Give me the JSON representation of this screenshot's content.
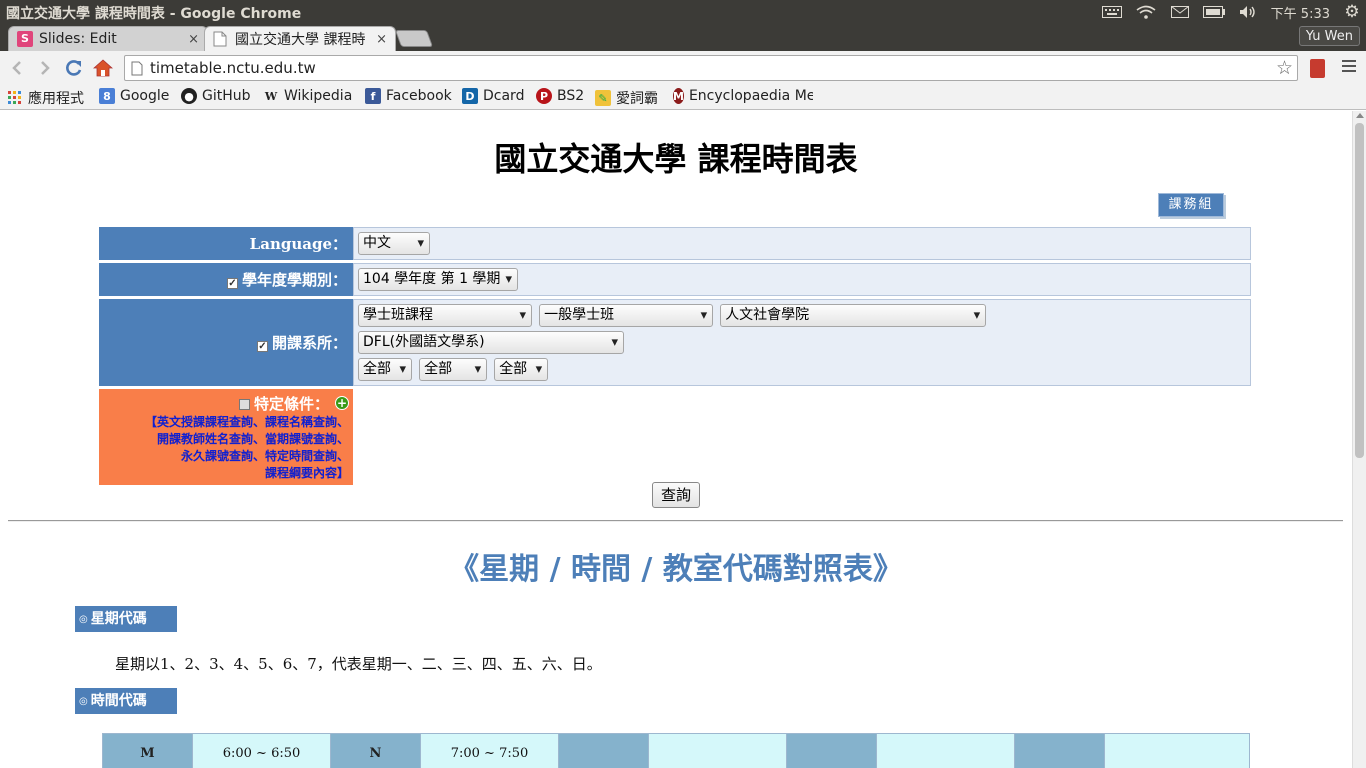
{
  "window": {
    "title": "國立交通大學 課程時間表 - Google Chrome"
  },
  "tray": {
    "clock": "下午 5:33"
  },
  "tabs": [
    {
      "label": "Slides: Edit",
      "close": "×"
    },
    {
      "label": "國立交通大學 課程時",
      "close": "×"
    }
  ],
  "user": "Yu Wen",
  "omnibox": {
    "url": "timetable.nctu.edu.tw"
  },
  "bookmarks": [
    {
      "label": "應用程式"
    },
    {
      "label": "Google"
    },
    {
      "label": "GitHub"
    },
    {
      "label": "Wikipedia"
    },
    {
      "label": "Facebook"
    },
    {
      "label": "Dcard"
    },
    {
      "label": "BS2"
    },
    {
      "label": "愛詞霸"
    },
    {
      "label": "Encyclopaedia Me"
    }
  ],
  "page": {
    "title": "國立交通大學 課程時間表",
    "office_button": "課務組",
    "form": {
      "language_label": "Language：",
      "language_value": "中文",
      "term_label": "學年度學期別：",
      "term_value": "104 學年度 第 1 學期",
      "dept_label": "開課系所：",
      "dept_selects": [
        "學士班課程",
        "一般學士班",
        "人文社會學院",
        "DFL(外國語文學系)"
      ],
      "dept_subselects": [
        "全部",
        "全部",
        "全部"
      ],
      "special_label": "特定條件：",
      "special_links": [
        "【英文授課課程查詢、課程名稱查詢、",
        "開課教師姓名查詢、當期課號查詢、",
        "永久課號查詢、特定時間查詢、",
        "課程綱要內容】"
      ]
    },
    "query_button": "查詢",
    "section_title": "《星期 / 時間 / 教室代碼對照表》",
    "weekday_header": "星期代碼",
    "weekday_text": "星期以1、2、3、4、5、6、7，代表星期一、二、三、四、五、六、日。",
    "time_header": "時間代碼",
    "time_rows": [
      [
        {
          "code": "M",
          "time": "6:00 ~ 6:50"
        },
        {
          "code": "N",
          "time": "7:00 ~ 7:50"
        },
        {
          "code": "",
          "time": ""
        },
        {
          "code": "",
          "time": ""
        },
        {
          "code": "",
          "time": ""
        }
      ]
    ]
  }
}
